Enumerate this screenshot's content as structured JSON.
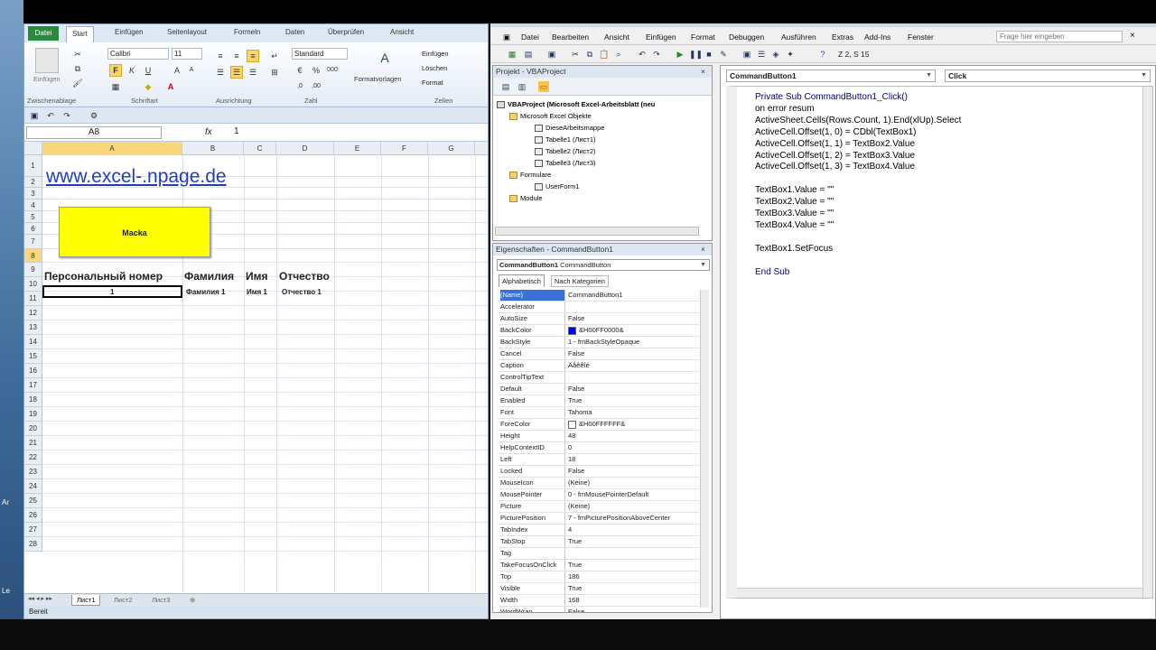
{
  "excel": {
    "ribbon_tabs": [
      "Datei",
      "Start",
      "Einfügen",
      "Seitenlayout",
      "Formeln",
      "Daten",
      "Überprüfen",
      "Ansicht"
    ],
    "groups": [
      "Zwischenablage",
      "Schriftart",
      "Ausrichtung",
      "Zahl",
      "Formatvorlagen",
      "Zellen"
    ],
    "paste_label": "Einfügen",
    "font_name": "Calibri",
    "font_size": "11",
    "number_format": "Standard",
    "cells_buttons": [
      "Einfügen",
      "Löschen",
      "Format"
    ],
    "name_box": "A8",
    "fx": "fx",
    "formula_value": "1",
    "columns": [
      "A",
      "B",
      "C",
      "D",
      "E",
      "F",
      "G"
    ],
    "rows": [
      "1",
      "2",
      "3",
      "4",
      "5",
      "6",
      "7",
      "8",
      "9",
      "10",
      "11",
      "12",
      "13",
      "14",
      "15",
      "16",
      "17",
      "18",
      "19",
      "20",
      "21",
      "22",
      "23",
      "24",
      "25",
      "26",
      "27",
      "28"
    ],
    "url": "www.excel-.npage.de",
    "macro_button": "Macka",
    "headers": [
      "Персональный номер",
      "Фамилия",
      "Имя",
      "Отчество"
    ],
    "row8": [
      "1",
      "Фамилия 1",
      "Имя 1",
      "Отчество 1"
    ],
    "sheets": [
      "Лист1",
      "Лист2",
      "Лист3"
    ],
    "status": "Bereit"
  },
  "vba": {
    "menu": [
      "Datei",
      "Bearbeiten",
      "Ansicht",
      "Einfügen",
      "Format",
      "Debuggen",
      "Ausführen",
      "Extras",
      "Add-Ins",
      "Fenster"
    ],
    "help_placeholder": "Frage hier eingeben",
    "cursor_pos": "Z 2, S 15",
    "project_title": "Projekt - VBAProject",
    "tree": [
      "VBAProject (Microsoft Excel-Arbeitsblatt (neu",
      "Microsoft Excel Objekte",
      "DieseArbeitsmappe",
      "Tabelle1 (Лист1)",
      "Tabelle2 (Лист2)",
      "Tabelle3 (Лист3)",
      "Formulare",
      "UserForm1",
      "Module"
    ],
    "props_title": "Eigenschaften - CommandButton1",
    "props_object": "CommandButton1",
    "props_type": "CommandButton",
    "props_tabs": [
      "Alphabetisch",
      "Nach Kategorien"
    ],
    "props": [
      [
        "(Name)",
        "CommandButton1"
      ],
      [
        "Accelerator",
        ""
      ],
      [
        "AutoSize",
        "False"
      ],
      [
        "BackColor",
        "&H00FF0000&"
      ],
      [
        "BackStyle",
        "1 - fmBackStyleOpaque"
      ],
      [
        "Cancel",
        "False"
      ],
      [
        "Caption",
        "Äåêêîé"
      ],
      [
        "ControlTipText",
        ""
      ],
      [
        "Default",
        "False"
      ],
      [
        "Enabled",
        "True"
      ],
      [
        "Font",
        "Tahoma"
      ],
      [
        "ForeColor",
        "&H00FFFFFF&"
      ],
      [
        "Height",
        "48"
      ],
      [
        "HelpContextID",
        "0"
      ],
      [
        "Left",
        "18"
      ],
      [
        "Locked",
        "False"
      ],
      [
        "MouseIcon",
        "(Keine)"
      ],
      [
        "MousePointer",
        "0 - fmMousePointerDefault"
      ],
      [
        "Picture",
        "(Keine)"
      ],
      [
        "PicturePosition",
        "7 - fmPicturePositionAboveCenter"
      ],
      [
        "TabIndex",
        "4"
      ],
      [
        "TabStop",
        "True"
      ],
      [
        "Tag",
        ""
      ],
      [
        "TakeFocusOnClick",
        "True"
      ],
      [
        "Top",
        "186"
      ],
      [
        "Visible",
        "True"
      ],
      [
        "Width",
        "168"
      ],
      [
        "WordWrap",
        "False"
      ]
    ],
    "code_object": "CommandButton1",
    "code_proc": "Click",
    "code": [
      "Private Sub CommandButton1_Click()",
      "on error resum",
      "ActiveSheet.Cells(Rows.Count, 1).End(xlUp).Select",
      "ActiveCell.Offset(1, 0) = CDbl(TextBox1)",
      "ActiveCell.Offset(1, 1) = TextBox2.Value",
      "ActiveCell.Offset(1, 2) = TextBox3.Value",
      "ActiveCell.Offset(1, 3) = TextBox4.Value",
      "",
      "TextBox1.Value = \"\"",
      "TextBox2.Value = \"\"",
      "TextBox3.Value = \"\"",
      "TextBox4.Value = \"\"",
      "",
      "TextBox1.SetFocus",
      "",
      "End Sub"
    ]
  },
  "desktop_labels": [
    "Ar",
    "Le"
  ]
}
